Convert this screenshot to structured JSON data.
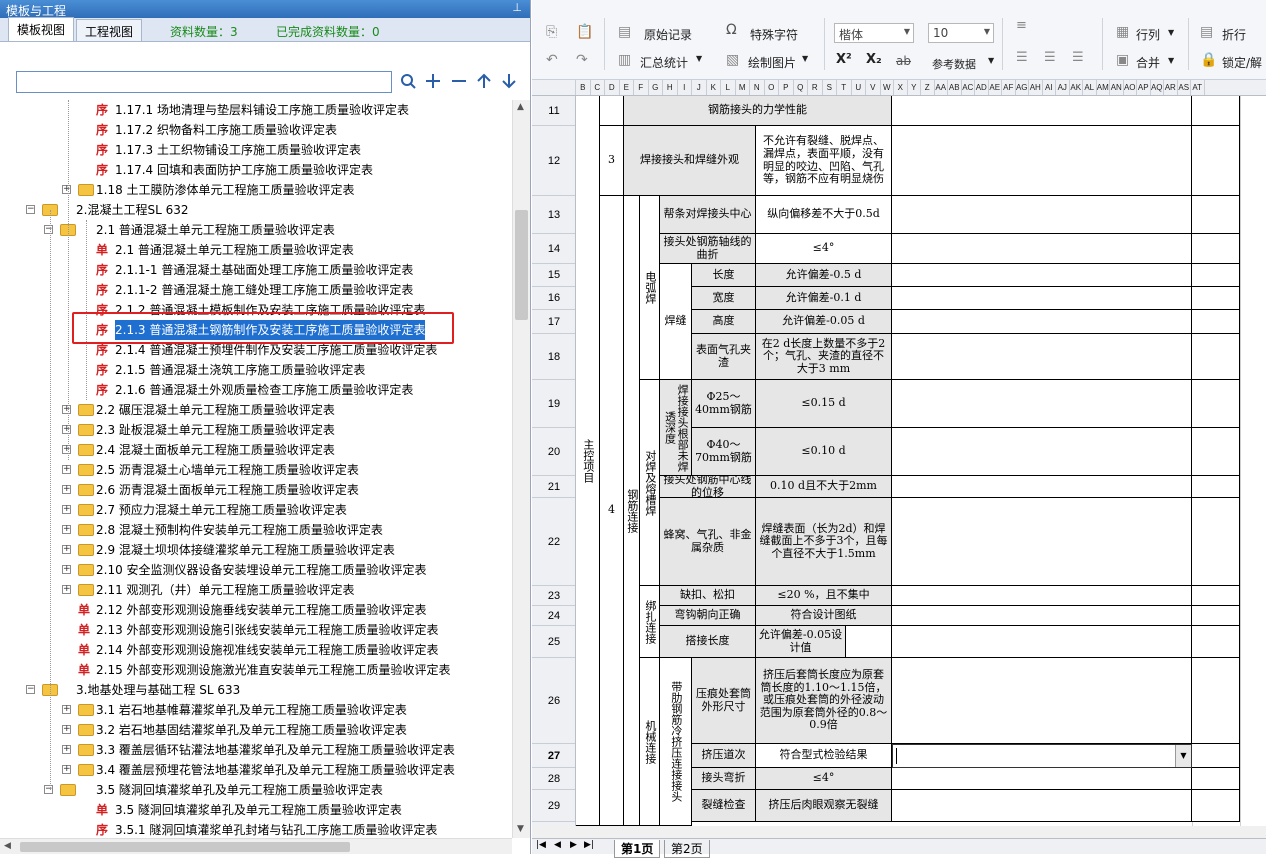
{
  "left_panel": {
    "title": "模板与工程",
    "pin": "⊥",
    "tabs": [
      "模板视图",
      "工程视图"
    ],
    "stats": {
      "count_label": "资料数量：3",
      "done_label": "已完成资料数量：0"
    },
    "search": {
      "value": "",
      "placeholder": ""
    },
    "tree": [
      {
        "icon": "序",
        "label": "1.17.1 场地清理与垫层料铺设工序施工质量验收评定表"
      },
      {
        "icon": "序",
        "label": "1.17.2 织物备料工序施工质量验收评定表"
      },
      {
        "icon": "序",
        "label": "1.17.3 土工织物铺设工序施工质量验收评定表"
      },
      {
        "icon": "序",
        "label": "1.17.4 回填和表面防护工序施工质量验收评定表"
      },
      {
        "icon": "folder",
        "label": "1.18 土工膜防渗体单元工程施工质量验收评定表"
      },
      {
        "icon": "folder",
        "label": "2.混凝土工程SL 632"
      },
      {
        "icon": "folder",
        "label": "2.1 普通混凝土单元工程施工质量验收评定表"
      },
      {
        "icon": "单",
        "label": "2.1 普通混凝土单元工程施工质量验收评定表"
      },
      {
        "icon": "序",
        "label": "2.1.1-1 普通混凝土基础面处理工序施工质量验收评定表"
      },
      {
        "icon": "序",
        "label": "2.1.1-2 普通混凝土施工缝处理工序施工质量验收评定表"
      },
      {
        "icon": "序",
        "label": "2.1.2 普通混凝土模板制作及安装工序施工质量验收评定表"
      },
      {
        "icon": "序",
        "label": "2.1.3 普通混凝土钢筋制作及安装工序施工质量验收评定表"
      },
      {
        "icon": "序",
        "label": "2.1.4 普通混凝土预埋件制作及安装工序施工质量验收评定表"
      },
      {
        "icon": "序",
        "label": "2.1.5 普通混凝土浇筑工序施工质量验收评定表"
      },
      {
        "icon": "序",
        "label": "2.1.6 普通混凝土外观质量检查工序施工质量验收评定表"
      },
      {
        "icon": "folder",
        "label": "2.2 碾压混凝土单元工程施工质量验收评定表"
      },
      {
        "icon": "folder",
        "label": "2.3 趾板混凝土单元工程施工质量验收评定表"
      },
      {
        "icon": "folder",
        "label": "2.4 混凝土面板单元工程施工质量验收评定表"
      },
      {
        "icon": "folder",
        "label": "2.5 沥青混凝土心墙单元工程施工质量验收评定表"
      },
      {
        "icon": "folder",
        "label": "2.6 沥青混凝土面板单元工程施工质量验收评定表"
      },
      {
        "icon": "folder",
        "label": "2.7 预应力混凝土单元工程施工质量验收评定表"
      },
      {
        "icon": "folder",
        "label": "2.8 混凝土预制构件安装单元工程施工质量验收评定表"
      },
      {
        "icon": "folder",
        "label": "2.9 混凝土坝坝体接缝灌浆单元工程施工质量验收评定表"
      },
      {
        "icon": "folder",
        "label": "2.10 安全监测仪器设备安装埋设单元工程施工质量验收评定表"
      },
      {
        "icon": "folder",
        "label": "2.11 观测孔（井）单元工程施工质量验收评定表"
      },
      {
        "icon": "单",
        "label": "2.12 外部变形观测设施垂线安装单元工程施工质量验收评定表"
      },
      {
        "icon": "单",
        "label": "2.13 外部变形观测设施引张线安装单元工程施工质量验收评定表"
      },
      {
        "icon": "单",
        "label": "2.14 外部变形观测设施视准线安装单元工程施工质量验收评定表"
      },
      {
        "icon": "单",
        "label": "2.15 外部变形观测设施激光准直安装单元工程施工质量验收评定表"
      },
      {
        "icon": "folder",
        "label": "3.地基处理与基础工程 SL 633"
      },
      {
        "icon": "folder",
        "label": "3.1 岩石地基帷幕灌浆单孔及单元工程施工质量验收评定表"
      },
      {
        "icon": "folder",
        "label": "3.2 岩石地基固结灌浆单孔及单元工程施工质量验收评定表"
      },
      {
        "icon": "folder",
        "label": "3.3 覆盖层循环钻灌法地基灌浆单孔及单元工程施工质量验收评定表"
      },
      {
        "icon": "folder",
        "label": "3.4 覆盖层预埋花管法地基灌浆单孔及单元工程施工质量验收评定表"
      },
      {
        "icon": "folder",
        "label": "3.5 隧洞回填灌浆单孔及单元工程施工质量验收评定表"
      },
      {
        "icon": "单",
        "label": "3.5 隧洞回填灌浆单孔及单元工程施工质量验收评定表"
      },
      {
        "icon": "序",
        "label": "3.5.1 隧洞回填灌浆单孔封堵与钻孔工序施工质量验收评定表"
      }
    ]
  },
  "toolbar": {
    "original_record": "原始记录",
    "special_char": "特殊字符",
    "font_name": "楷体",
    "font_size": "10",
    "row_col": "行列",
    "fold_row": "折行",
    "summary_stats": "汇总统计",
    "draw_image": "绘制图片",
    "ref_data": "参考数据",
    "merge": "合并",
    "lock": "锁定/解",
    "sup": "X²",
    "sub": "X₂",
    "strike": "ab"
  },
  "columns": [
    "B",
    "C",
    "D",
    "E",
    "F",
    "G",
    "H",
    "I",
    "J",
    "K",
    "L",
    "M",
    "N",
    "O",
    "P",
    "Q",
    "R",
    "S",
    "T",
    "U",
    "V",
    "W",
    "X",
    "Y",
    "Z",
    "AA",
    "AB",
    "AC",
    "AD",
    "AE",
    "AF",
    "AG",
    "AH",
    "AI",
    "AJ",
    "AK",
    "AL",
    "AM",
    "AN",
    "AO",
    "AP",
    "AQ",
    "AR",
    "AS",
    "AT"
  ],
  "rows": [
    "11",
    "12",
    "13",
    "14",
    "15",
    "16",
    "17",
    "18",
    "19",
    "20",
    "21",
    "22",
    "23",
    "24",
    "25",
    "26",
    "27",
    "28",
    "29"
  ],
  "table": {
    "main_ctrl": "主控项目",
    "r11_b": "钢筋接头的力学性能",
    "r12_no": "3",
    "r12_item": "焊接接头和焊缝外观",
    "r12_std": "不允许有裂缝、脱焊点、漏焊点，表面平顺，没有明显的咬边、凹陷、气孔等，钢筋不应有明显烧伤",
    "no4": "4",
    "steel_conn": "钢筋连接",
    "arc_weld": "电弧焊",
    "r13_item": "帮条对焊接头中心",
    "r13_std": "纵向偏移差不大于0.5d",
    "r14_item": "接头处钢筋轴线的曲折",
    "r14_std": "≤4°",
    "weld_seam": "焊缝",
    "r15_item": "长度",
    "r15_std": "允许偏差-0.5 d",
    "r16_item": "宽度",
    "r16_std": "允许偏差-0.1 d",
    "r17_item": "高度",
    "r17_std": "允许偏差-0.05 d",
    "r18_item": "表面气孔夹渣",
    "r18_std": "在2 d长度上数量不多于2个；气孔、夹渣的直径不大于3 mm",
    "butt_weld": "对焊及熔槽焊",
    "root_pen": "焊接接头根部未焊透深度",
    "r19_item": "Φ25～40mm钢筋",
    "r19_std": "≤0.15 d",
    "r20_item": "Φ40～70mm钢筋",
    "r20_std": "≤0.10 d",
    "r21_item": "接头处钢筋中心线的位移",
    "r21_std": "0.10 d且不大于2mm",
    "r22_item": "蜂窝、气孔、非金属杂质",
    "r22_std": "焊缝表面（长为2d）和焊缝截面上不多于3个，且每个直径不大于1.5mm",
    "tie_conn": "绑扎连接",
    "r23_item": "缺扣、松扣",
    "r23_std": "≤20 %，且不集中",
    "r24_item": "弯钩朝向正确",
    "r24_std": "符合设计图纸",
    "r25_item": "搭接长度",
    "r25_std": "允许偏差-0.05设计值",
    "mech_conn": "机械连接",
    "ribbed_sleeve": "带肋钢筋冷挤压连接接头",
    "r26_item": "压痕处套筒外形尺寸",
    "r26_std": "挤压后套筒长度应为原套筒长度的1.10～1.15倍，或压痕处套筒的外径波动范围为原套筒外径的0.8～0.9倍",
    "r27_item": "挤压道次",
    "r27_std": "符合型式检验结果",
    "r28_item": "接头弯折",
    "r28_std": "≤4°",
    "r29_item": "裂缝检查",
    "r29_std": "挤压后肉眼观察无裂缝"
  },
  "sheet_tabs": [
    "第1页",
    "第2页"
  ],
  "colors": {
    "title_bar": "#2f6db8",
    "highlight": "#1e6fd0",
    "red_box": "#e02020",
    "green_stat": "#1a8a1a",
    "gray_cell": "#e6e6e6"
  }
}
